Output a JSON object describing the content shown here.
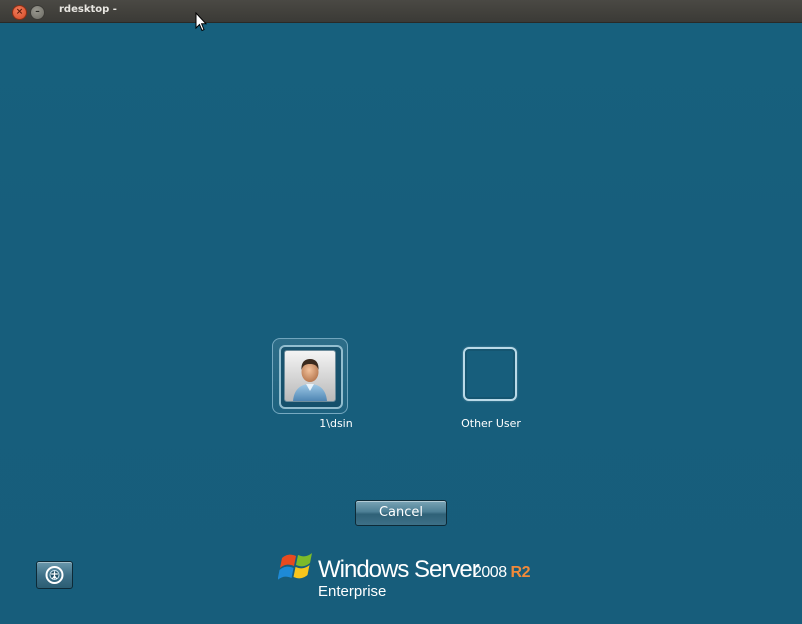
{
  "window": {
    "title": "rdesktop -",
    "close_glyph": "×",
    "minimize_glyph": "–"
  },
  "users": [
    {
      "name": "1\\dsin",
      "icon": "user-avatar-icon"
    },
    {
      "name": "Other User",
      "icon": "blank-user-tile"
    }
  ],
  "actions": {
    "cancel_label": "Cancel"
  },
  "ease_of_access": {
    "icon": "ease-of-access-icon"
  },
  "branding": {
    "product": "Windows Server",
    "version": "2008",
    "release": "R2",
    "edition": "Enterprise"
  },
  "colors": {
    "background": "#175e7c",
    "titlebar": "#3b3a36",
    "release_accent": "#f08a3a"
  }
}
